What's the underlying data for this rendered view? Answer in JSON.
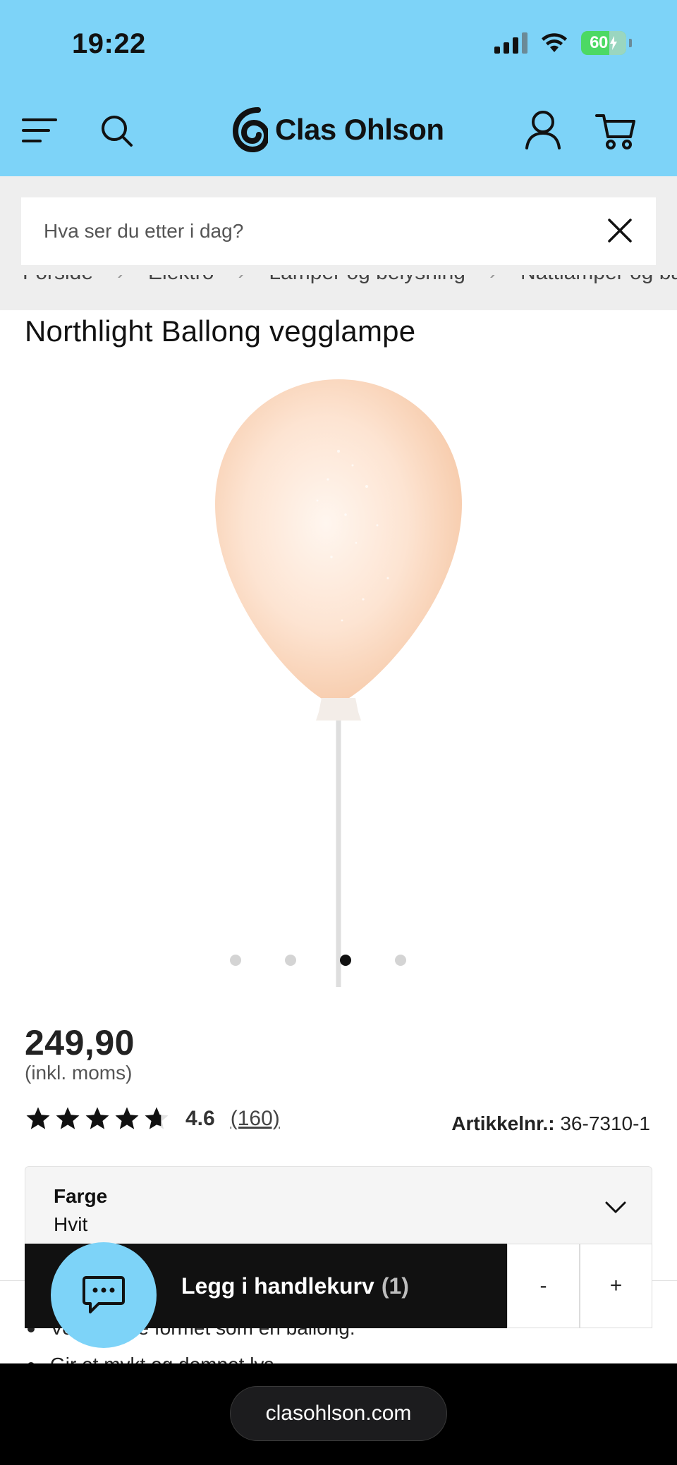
{
  "status_bar": {
    "time": "19:22",
    "battery": "60"
  },
  "header": {
    "brand": "Clas Ohlson",
    "icons": {
      "menu": "menu-icon",
      "search": "search-icon",
      "account": "user-icon",
      "cart": "cart-icon"
    },
    "accent_color": "#7dd3f8"
  },
  "search": {
    "placeholder": "Hva ser du etter i dag?"
  },
  "breadcrumb": [
    "Forside",
    "Elektro",
    "Lamper og belysning",
    "Nattlamper og barnelamper"
  ],
  "product": {
    "title": "Northlight Ballong vegglampe",
    "image_count": 4,
    "active_image_index": 2,
    "price": "249,90",
    "price_note": "(inkl. moms)",
    "rating": "4.6",
    "rating_fraction": 0.92,
    "review_count": "(160)",
    "sku_label": "Artikkelnr.:",
    "sku_value": "36-7310-1"
  },
  "color_selector": {
    "label": "Farge",
    "value": "Hvit"
  },
  "features": [
    "Vegglampe formet som en ballong.",
    "Gir et mykt og dempet lys."
  ],
  "cart_bar": {
    "add_label": "Legg i handlekurv",
    "quantity": "(1)",
    "minus": "-",
    "plus": "+"
  },
  "browser": {
    "url": "clasohlson.com"
  }
}
